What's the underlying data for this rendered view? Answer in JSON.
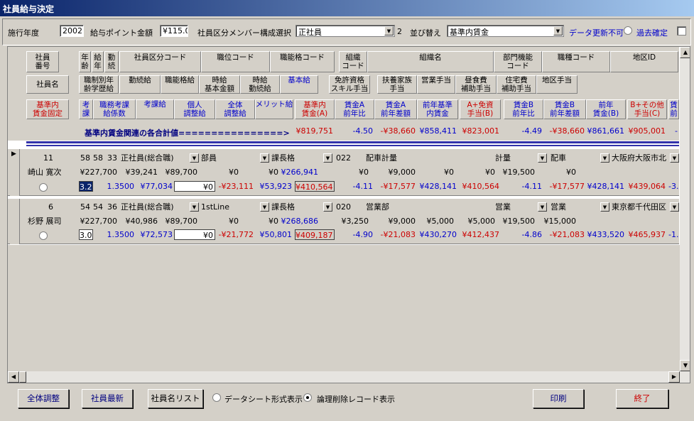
{
  "window": {
    "title": "社員給与決定"
  },
  "top": {
    "year_label": "施行年度",
    "year": "2002",
    "point_label": "給与ポイント金額",
    "point": "¥115.0",
    "class_label": "社員区分メンバー構成選択",
    "class": "正社員",
    "class_no": "2",
    "sort_label": "並び替え",
    "sort": "基準内賃金",
    "no_update": "データ更新不可",
    "past": "過去確定"
  },
  "headers": {
    "r1": [
      "社員\n番号",
      "年\n齢",
      "給\n年",
      "勤\n続",
      "社員区分コード",
      "職位コード",
      "職能格コード",
      "組織\nコード",
      "組織名",
      "部門機能\nコード",
      "職種コード",
      "地区ID"
    ],
    "r2": [
      "社員名",
      "職制別年\n齢学歴給",
      "勤続給",
      "職能格給",
      "時給\n基本金額",
      "時給\n勤続給",
      "基本給",
      "免許資格\nスキル手当",
      "扶養家族\n手当",
      "営業手当",
      "昼食費\n補助手当",
      "住宅費\n補助手当",
      "地区手当"
    ],
    "r3": [
      "基準内\n賃金固定",
      "考\n課",
      "職務考課\n給係数",
      "考課給",
      "個人\n調整給",
      "全体\n調整給",
      "メリット給",
      "基準内\n賃金(A)",
      "賃金A\n前年比",
      "賃金A\n前年差額",
      "前年基準\n内賃金",
      "A+免資\n手当(B)",
      "賃金B\n前年比",
      "賃金B\n前年差額",
      "前年\n賃金(B)",
      "B+その他\n手当(C)",
      "賃\n前"
    ]
  },
  "summary": {
    "label": "基準内賃金関連の各合計値================>",
    "values": [
      "¥819,751",
      "-4.50",
      "-¥38,660",
      "¥858,411",
      "¥823,001",
      "-4.49",
      "-¥38,660",
      "¥861,661",
      "¥905,001",
      "-"
    ]
  },
  "records": [
    {
      "no": "11",
      "age": "58",
      "kyunen": "58",
      "kinzoku": "33",
      "kubun": "正社員(総合職)",
      "shii": "部員",
      "shokuno": "課長格",
      "soshiki_code": "022",
      "soshiki": "配車計量",
      "bumon": "計量",
      "shokushu": "配車",
      "chiku": "大阪府大阪市北",
      "name": "崎山 寛次",
      "r2": [
        "¥227,700",
        "¥39,241",
        "¥89,700",
        "¥0",
        "¥0",
        "¥266,941",
        "¥0",
        "¥9,000",
        "¥0",
        "¥0",
        "¥19,500",
        "¥0"
      ],
      "kouka": "3.2",
      "r3": [
        "1.3500",
        "¥77,034",
        "¥0",
        "-¥23,111",
        "¥53,923",
        "¥410,564",
        "-4.11",
        "-¥17,577",
        "¥428,141",
        "¥410,564",
        "-4.11",
        "-¥17,577",
        "¥428,141",
        "¥439,064",
        "-3."
      ]
    },
    {
      "no": "6",
      "age": "54",
      "kyunen": "54",
      "kinzoku": "36",
      "kubun": "正社員(総合職)",
      "shii": "1stLine",
      "shokuno": "課長格",
      "soshiki_code": "020",
      "soshiki": "営業部",
      "bumon": "営業",
      "shokushu": "営業",
      "chiku": "東京都千代田区",
      "name": "杉野 展司",
      "r2": [
        "¥227,700",
        "¥40,986",
        "¥89,700",
        "¥0",
        "¥0",
        "¥268,686",
        "¥3,250",
        "¥9,000",
        "¥5,000",
        "¥5,000",
        "¥19,500",
        "¥15,000"
      ],
      "kouka": "3.0",
      "r3": [
        "1.3500",
        "¥72,573",
        "¥0",
        "-¥21,772",
        "¥50,801",
        "¥409,187",
        "-4.90",
        "-¥21,083",
        "¥430,270",
        "¥412,437",
        "-4.86",
        "-¥21,083",
        "¥433,520",
        "¥465,937",
        "-1."
      ]
    }
  ],
  "buttons": {
    "all_adjust": "全体調整",
    "latest": "社員最新",
    "list": "社員名リスト",
    "sheet_view": "データシート形式表示",
    "deleted_view": "論理削除レコード表示",
    "print": "印刷",
    "exit": "終了"
  }
}
